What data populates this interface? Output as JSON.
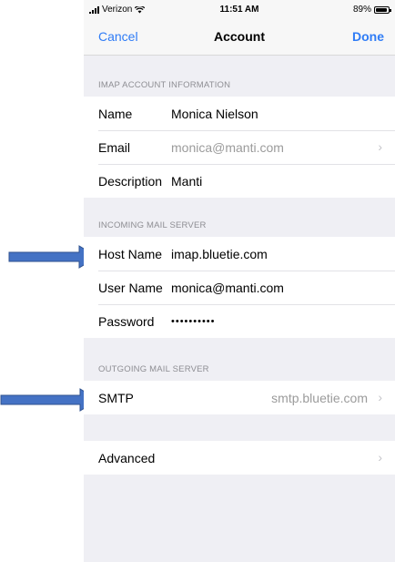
{
  "status": {
    "carrier": "Verizon",
    "time": "11:51 AM",
    "battery": "89%",
    "battery_level": 0.89
  },
  "nav": {
    "cancel": "Cancel",
    "title": "Account",
    "done": "Done"
  },
  "imap": {
    "header": "IMAP ACCOUNT INFORMATION",
    "name_label": "Name",
    "name_value": "Monica Nielson",
    "email_label": "Email",
    "email_value": "monica@manti.com",
    "description_label": "Description",
    "description_value": "Manti"
  },
  "incoming": {
    "header": "INCOMING MAIL SERVER",
    "host_label": "Host Name",
    "host_value": "imap.bluetie.com",
    "user_label": "User Name",
    "user_value": "monica@manti.com",
    "password_label": "Password",
    "password_value": "••••••••••"
  },
  "outgoing": {
    "header": "OUTGOING MAIL SERVER",
    "smtp_label": "SMTP",
    "smtp_value": "smtp.bluetie.com"
  },
  "advanced": {
    "label": "Advanced"
  },
  "icons": {
    "chevron": "›",
    "wifi": "wifi-icon",
    "battery": "battery-icon",
    "signal": "signal-icon",
    "arrow": "arrow-right-icon"
  },
  "colors": {
    "accent": "#2f7cf6",
    "annotation_arrow": "#3f6fc6",
    "group_bg": "#efeff4"
  }
}
